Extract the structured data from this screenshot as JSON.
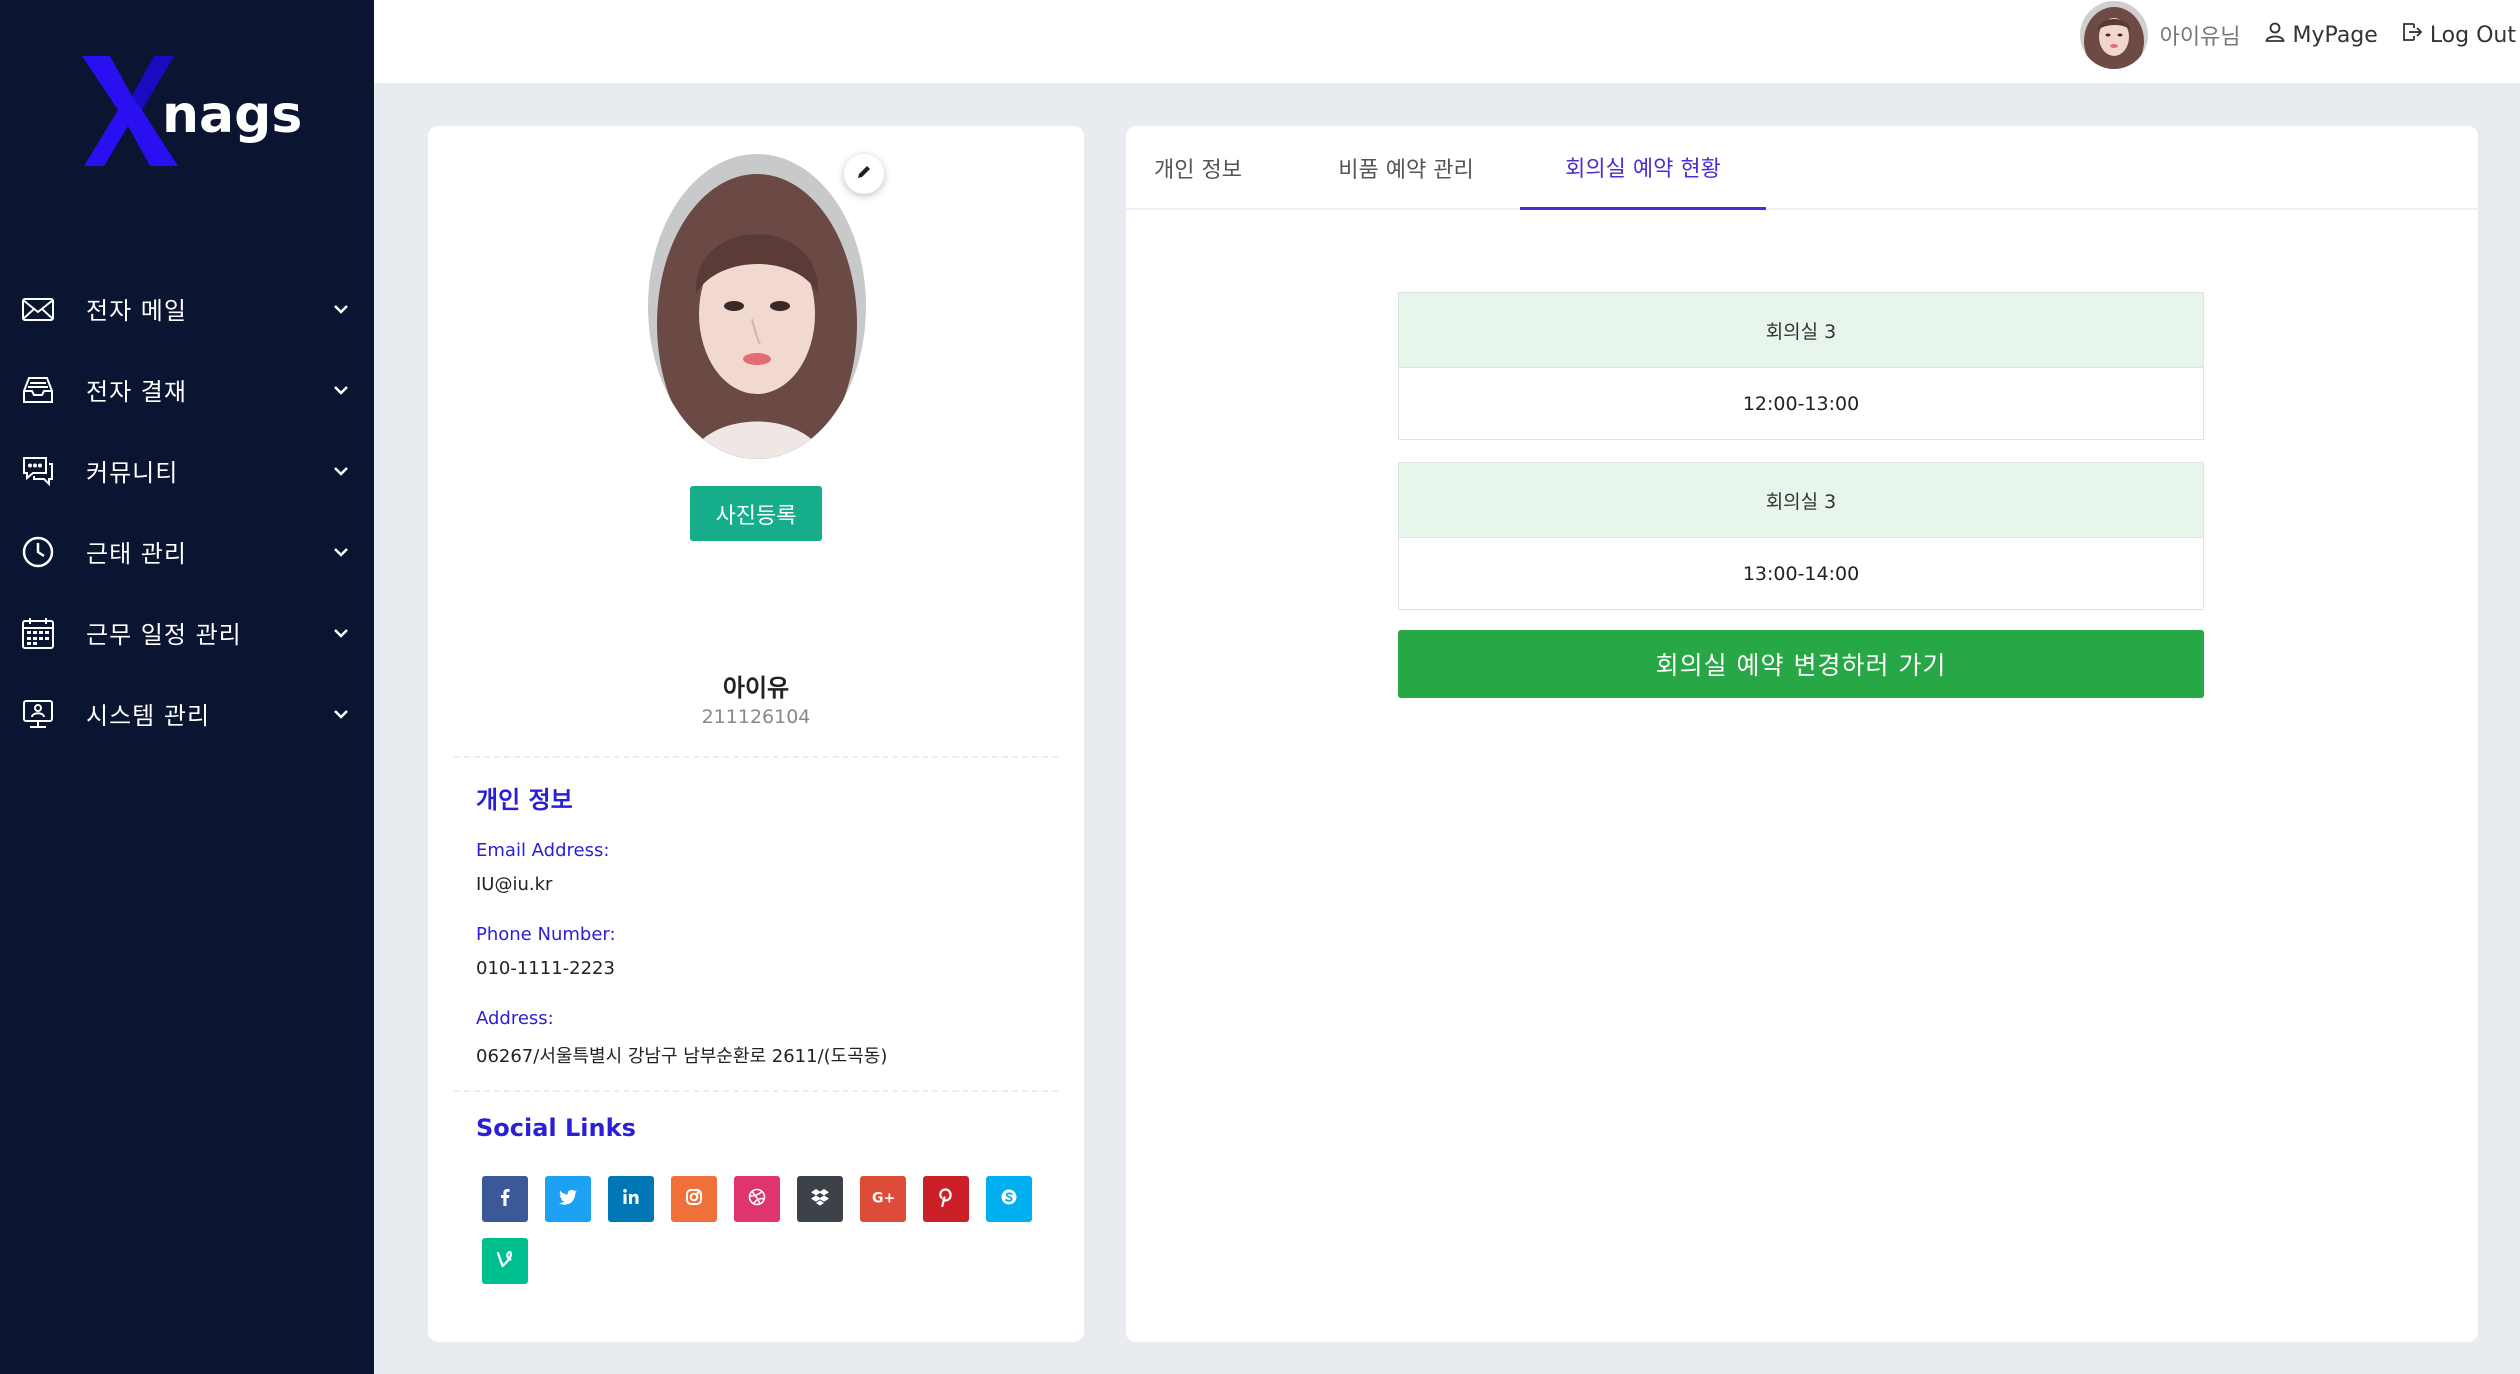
{
  "app": {
    "logo_text": "nags",
    "logo_letter": "X"
  },
  "sidebar": {
    "items": [
      {
        "label": "전자 메일",
        "icon": "mail-icon"
      },
      {
        "label": "전자 결재",
        "icon": "inbox-tray-icon"
      },
      {
        "label": "커뮤니티",
        "icon": "chat-bubbles-icon"
      },
      {
        "label": "근태 관리",
        "icon": "clock-icon"
      },
      {
        "label": "근무 일정 관리",
        "icon": "calendar-icon"
      },
      {
        "label": "시스템 관리",
        "icon": "monitor-user-icon"
      }
    ]
  },
  "header": {
    "username": "아이유님",
    "mypage_label": "MyPage",
    "logout_label": "Log Out"
  },
  "profile": {
    "upload_label": "사진등록",
    "name": "아이유",
    "employee_id": "211126104",
    "section_title": "개인 정보",
    "email_label": "Email Address:",
    "email_value": "IU@iu.kr",
    "phone_label": "Phone Number:",
    "phone_value": "010-1111-2223",
    "address_label": "Address:",
    "address_value": "06267/서울특별시 강남구 남부순환로 2611/(도곡동)",
    "social_title": "Social Links",
    "socials": [
      {
        "icon": "facebook-icon",
        "color": "#3b5998"
      },
      {
        "icon": "twitter-icon",
        "color": "#1da1f2"
      },
      {
        "icon": "linkedin-icon",
        "color": "#0077b5"
      },
      {
        "icon": "instagram-icon",
        "color": "#f0703a"
      },
      {
        "icon": "dribbble-icon",
        "color": "#e0356c"
      },
      {
        "icon": "dropbox-icon",
        "color": "#3d4148"
      },
      {
        "icon": "google-plus-icon",
        "color": "#dd4b39"
      },
      {
        "icon": "pinterest-icon",
        "color": "#cb2027"
      },
      {
        "icon": "skype-icon",
        "color": "#00aff0"
      },
      {
        "icon": "vine-icon",
        "color": "#00bf8f"
      }
    ]
  },
  "tabs": [
    {
      "label": "개인 정보",
      "active": false
    },
    {
      "label": "비품 예약 관리",
      "active": false
    },
    {
      "label": "회의실 예약 현황",
      "active": true
    }
  ],
  "reservations": [
    {
      "room": "회의실 3",
      "time": "12:00-13:00"
    },
    {
      "room": "회의실 3",
      "time": "13:00-14:00"
    }
  ],
  "change_button_label": "회의실 예약 변경하러 가기",
  "colors": {
    "sidebar_bg": "#0b1431",
    "accent": "#2a1fd6",
    "upload_button": "#15ad8a",
    "change_button": "#27a745",
    "reservation_head_bg": "#e8f5ea"
  }
}
